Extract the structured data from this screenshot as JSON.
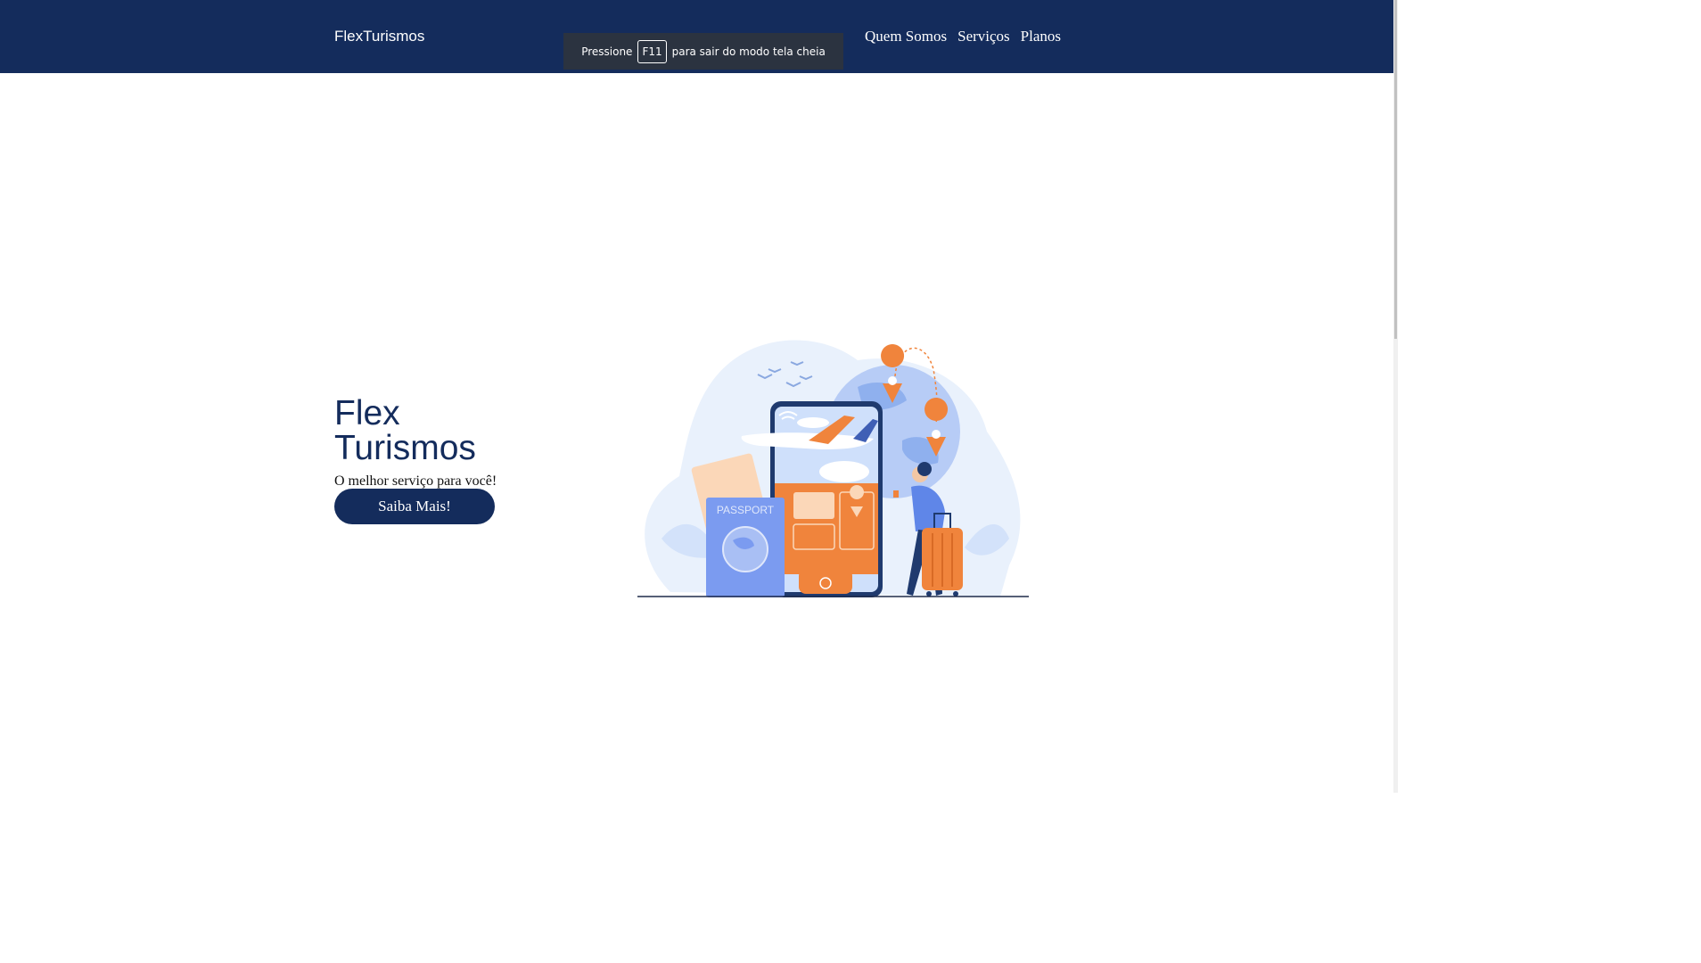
{
  "navbar": {
    "brand": "FlexTurismos",
    "links": [
      "Quem Somos",
      "Serviços",
      "Planos"
    ]
  },
  "fullscreen_toast": {
    "before": "Pressione",
    "key": "F11",
    "after": "para sair do modo tela cheia"
  },
  "hero": {
    "title_line1": "Flex",
    "title_line2": "Turismos",
    "subtitle": "O melhor serviço para você!",
    "button_label": "Saiba Mais!"
  },
  "illustration": {
    "passport_label": "PASSPORT",
    "icon": "travel-illustration"
  },
  "colors": {
    "navbar": "#142c5c",
    "accent": "#f0843c",
    "blue": "#7b9bf0"
  }
}
